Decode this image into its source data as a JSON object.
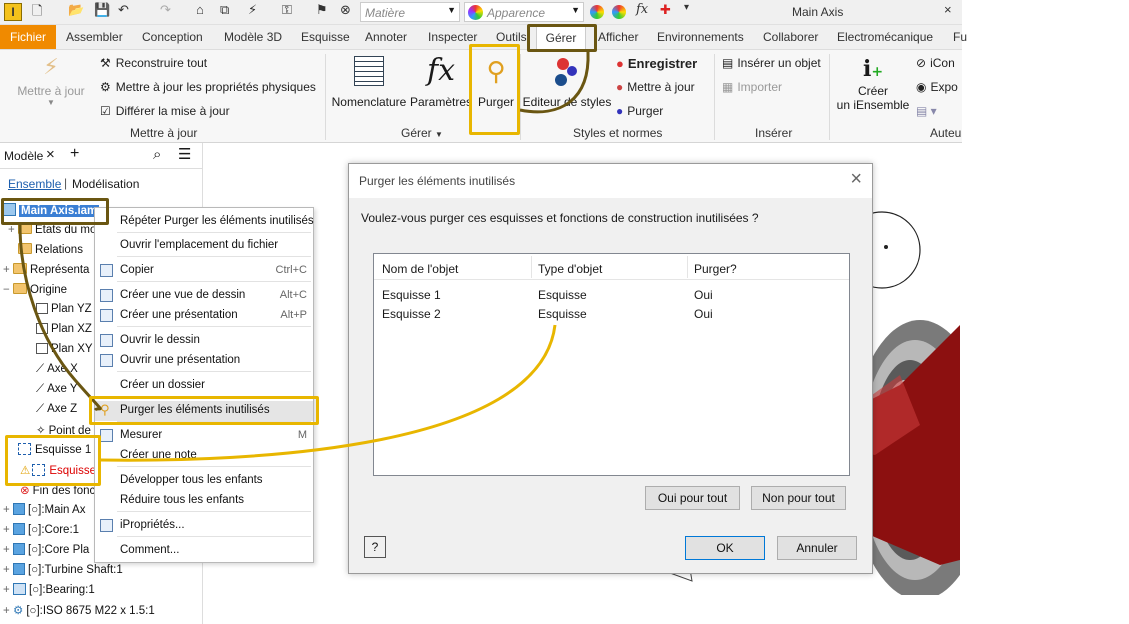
{
  "qat": {
    "material": "Matière",
    "appearance": "Apparence",
    "doc_title": "Main Axis"
  },
  "tabs": [
    "Fichier",
    "Assembler",
    "Conception",
    "Modèle 3D",
    "Esquisse",
    "Annoter",
    "Inspecter",
    "Outils",
    "Gérer",
    "Afficher",
    "Environnements",
    "Collaborer",
    "Electromécanique",
    "Fu"
  ],
  "ribbon": {
    "update": {
      "big": "Mettre à jour",
      "rebuild": "Reconstruire tout",
      "update_phys": "Mettre à jour les propriétés physiques",
      "defer": "Différer la mise à jour",
      "label": "Mettre à jour"
    },
    "manage": {
      "bom": "Nomenclature",
      "params": "Paramètres",
      "purge": "Purger",
      "label": "Gérer"
    },
    "styles": {
      "editor": "Editeur de styles",
      "save": "Enregistrer",
      "update": "Mettre à jour",
      "purge": "Purger",
      "label": "Styles et normes"
    },
    "insert": {
      "object": "Insérer un objet",
      "import": "Importer",
      "label": "Insérer"
    },
    "author": {
      "create1": "Créer",
      "create2": "un iEnsemble",
      "icon": "iCon",
      "export": "Expo",
      "label": "Auteu"
    }
  },
  "browser": {
    "tab": "Modèle",
    "mode1": "Ensemble",
    "mode2": "Modélisation",
    "items": [
      "Main Axis.iam",
      "États du mo",
      "Relations",
      "Représenta",
      "Origine",
      "Plan YZ",
      "Plan XZ",
      "Plan XY",
      "Axe X",
      "Axe Y",
      "Axe Z",
      "Point de",
      "Esquisse 1",
      "Esquisse",
      "Fin des fonc",
      "[○]:Main Ax",
      "[○]:Core:1",
      "[○]:Core Pla",
      "[○]:Turbine Shaft:1",
      "[○]:Bearing:1",
      "[○]:ISO 8675 M22 x 1.5:1"
    ]
  },
  "context_menu": [
    {
      "label": "Répéter Purger les éléments inutilisés",
      "key": ""
    },
    {
      "label": "Ouvrir l'emplacement du fichier",
      "key": ""
    },
    {
      "label": "Copier",
      "key": "Ctrl+C"
    },
    {
      "label": "Créer une vue de dessin",
      "key": "Alt+C"
    },
    {
      "label": "Créer une présentation",
      "key": "Alt+P"
    },
    {
      "label": "Ouvrir le dessin",
      "key": ""
    },
    {
      "label": "Ouvrir une présentation",
      "key": ""
    },
    {
      "label": "Créer un dossier",
      "key": ""
    },
    {
      "label": "Purger les éléments inutilisés",
      "key": ""
    },
    {
      "label": "Mesurer",
      "key": "M"
    },
    {
      "label": "Créer une note",
      "key": ""
    },
    {
      "label": "Développer tous les enfants",
      "key": ""
    },
    {
      "label": "Réduire tous les enfants",
      "key": ""
    },
    {
      "label": "iPropriétés...",
      "key": ""
    },
    {
      "label": "Comment...",
      "key": ""
    }
  ],
  "dialog": {
    "title": "Purger les éléments inutilisés",
    "question": "Voulez-vous purger ces esquisses et fonctions de construction inutilisées ?",
    "columns": [
      "Nom de l'objet",
      "Type d'objet",
      "Purger?"
    ],
    "rows": [
      [
        "Esquisse 1",
        "Esquisse",
        "Oui"
      ],
      [
        "Esquisse 2",
        "Esquisse",
        "Oui"
      ]
    ],
    "yes_all": "Oui pour tout",
    "no_all": "Non pour tout",
    "ok": "OK",
    "cancel": "Annuler",
    "help": "?"
  }
}
